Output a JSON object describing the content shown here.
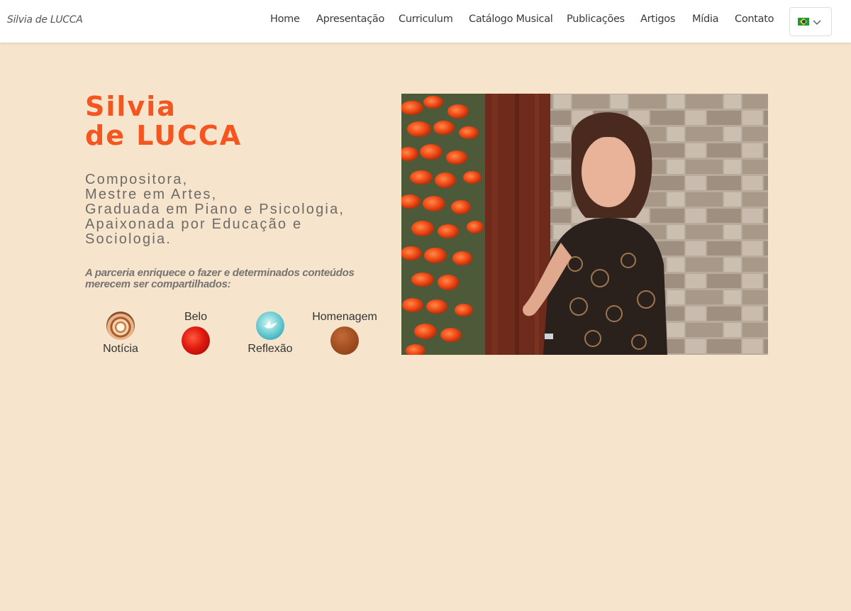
{
  "header": {
    "brand": "Silvia de LUCCA",
    "nav": [
      {
        "label": "Home"
      },
      {
        "label": "Apresentação"
      },
      {
        "label": "Curriculum"
      },
      {
        "label": "Catálogo Musical"
      },
      {
        "label": "Publicações"
      },
      {
        "label": "Artigos"
      },
      {
        "label": "Mídia"
      },
      {
        "label": "Contato"
      }
    ],
    "language": {
      "icon": "brazil-flag-icon"
    }
  },
  "hero": {
    "title_line1": "Silvia",
    "title_line2": "de LUCCA",
    "subtitle_lines": [
      "Compositora,",
      "Mestre em Artes,",
      "Graduada em Piano e Psicologia,",
      "Apaixonada por Educação e",
      "Sociologia."
    ],
    "quote": "A parceria enriquece o fazer e determinados conteúdos merecem ser compartilhados:"
  },
  "categories": [
    {
      "label": "Notícia",
      "icon": "spiral-shell-icon"
    },
    {
      "label": "Belo",
      "icon": "red-petal-icon"
    },
    {
      "label": "Reflexão",
      "icon": "dove-icon"
    },
    {
      "label": "Homenagem",
      "icon": "wood-grain-icon"
    }
  ],
  "photo": {
    "icon": "portrait-photo"
  },
  "colors": {
    "background": "#f6e5cc",
    "accent": "#f5551e",
    "text_muted": "#6e6b66"
  }
}
